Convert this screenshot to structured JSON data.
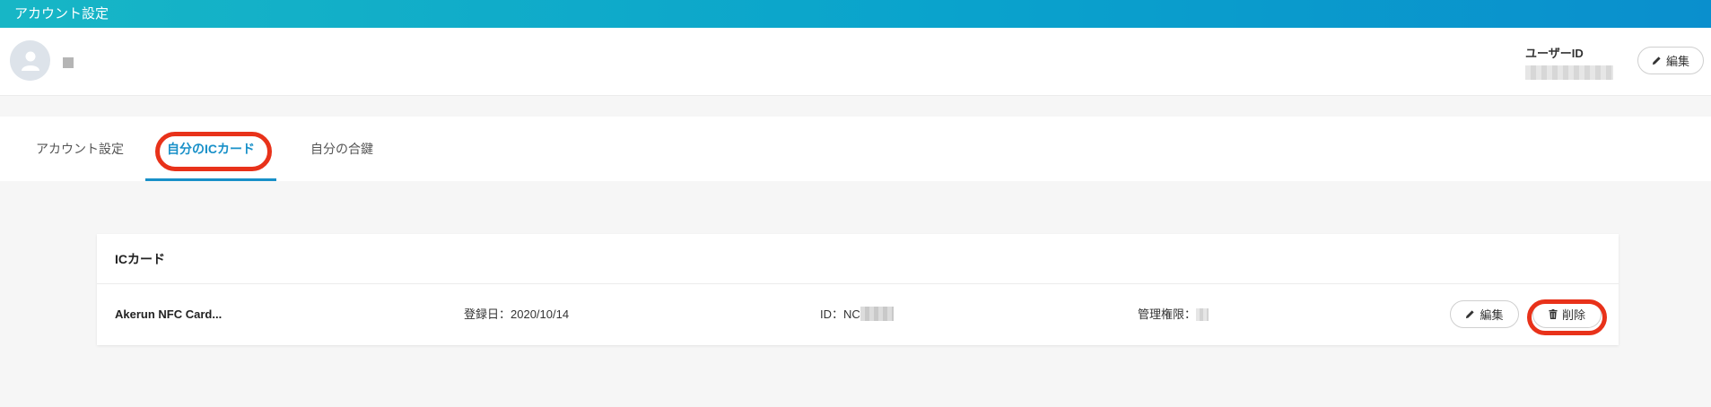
{
  "app": {
    "title": "アカウント設定"
  },
  "profile": {
    "user_id_label": "ユーザーID",
    "edit_label": "編集"
  },
  "tabs": [
    {
      "label": "アカウント設定",
      "active": false
    },
    {
      "label": "自分のICカード",
      "active": true
    },
    {
      "label": "自分の合鍵",
      "active": false
    }
  ],
  "card": {
    "title": "ICカード",
    "items": [
      {
        "name": "Akerun NFC Card...",
        "registered": "登録日：2020/10/14",
        "id_prefix": "ID：NC",
        "permission_label": "管理権限：",
        "edit_label": "編集",
        "delete_label": "削除"
      }
    ]
  },
  "colors": {
    "accent": "#1890c8",
    "header_gradient_start": "#17b6c6",
    "header_gradient_end": "#0a8fcd",
    "highlight": "#e8321a"
  },
  "icons": {
    "avatar": "user-avatar-icon",
    "edit": "pencil-icon",
    "delete": "trash-icon"
  }
}
